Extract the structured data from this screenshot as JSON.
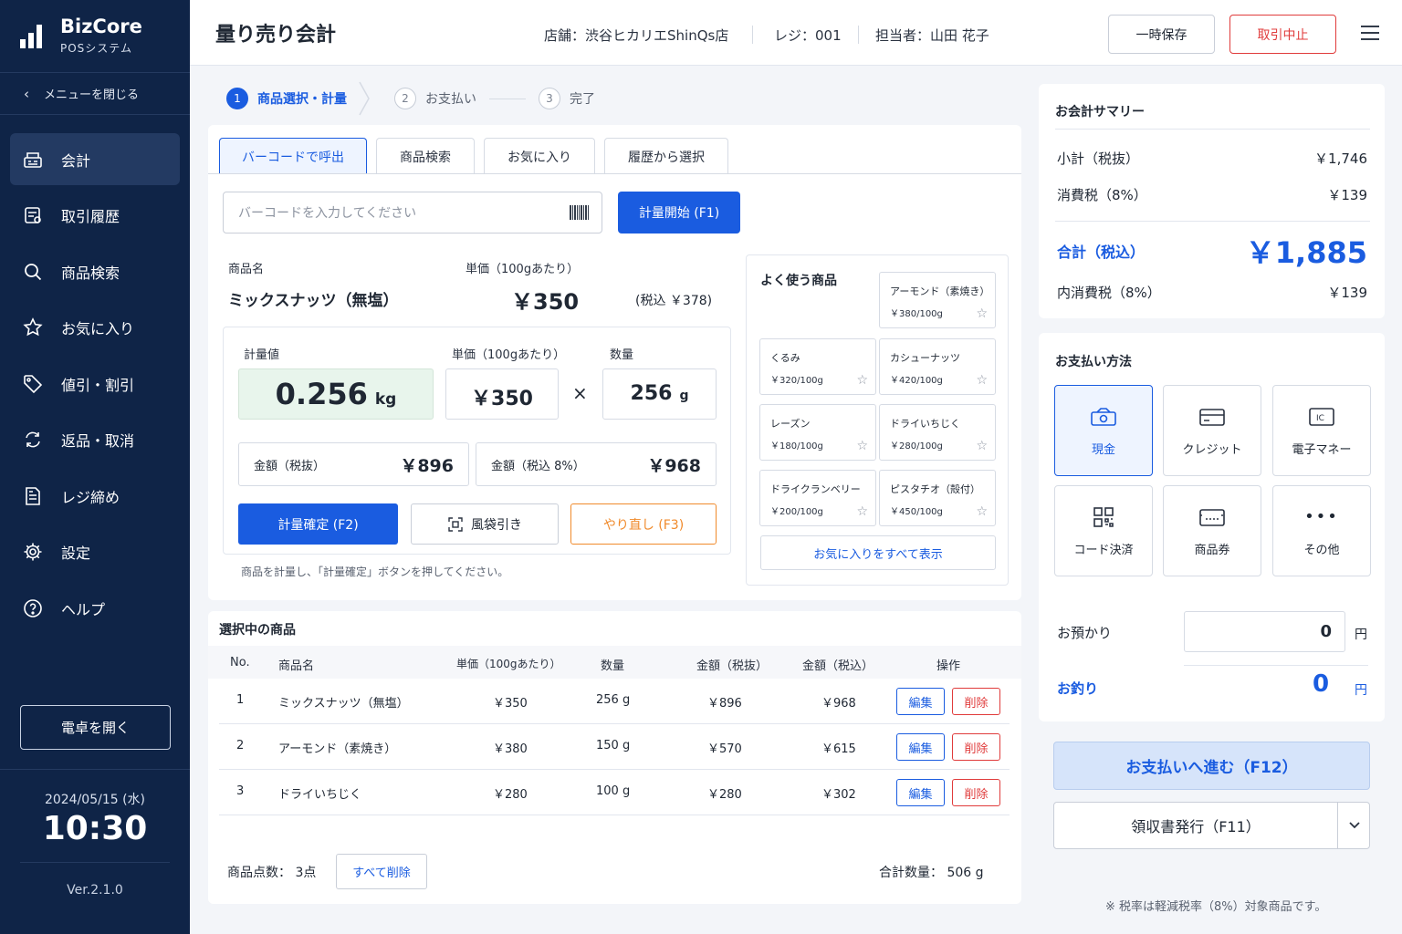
{
  "app": {
    "name": "BizCore",
    "subtitle": "POSシステム"
  },
  "sidebar": {
    "close_menu": "メニューを閉じる",
    "items": [
      {
        "label": "会計",
        "icon": "register-icon",
        "active": true
      },
      {
        "label": "取引履歴",
        "icon": "history-icon"
      },
      {
        "label": "商品検索",
        "icon": "search-icon"
      },
      {
        "label": "お気に入り",
        "icon": "star-icon"
      },
      {
        "label": "値引・割引",
        "icon": "tag-icon"
      },
      {
        "label": "返品・取消",
        "icon": "return-icon"
      },
      {
        "label": "レジ締め",
        "icon": "document-icon"
      },
      {
        "label": "設定",
        "icon": "gear-icon"
      },
      {
        "label": "ヘルプ",
        "icon": "help-icon"
      }
    ],
    "calculator_button": "電卓を開く",
    "date": "2024/05/15 (水)",
    "time": "10:30",
    "version": "Ver.2.1.0"
  },
  "header": {
    "title": "量り売り会計",
    "store": "店舗：渋谷ヒカリエShinQs店",
    "register": "レジ：001",
    "staff": "担当者：山田 花子",
    "save_button": "一時保存",
    "cancel_button": "取引中止"
  },
  "stepper": [
    {
      "num": "1",
      "label": "商品選択・計量",
      "active": true
    },
    {
      "num": "2",
      "label": "お支払い"
    },
    {
      "num": "3",
      "label": "完了"
    }
  ],
  "tabs": [
    "バーコードで呼出",
    "商品検索",
    "お気に入り",
    "履歴から選択"
  ],
  "barcode": {
    "placeholder": "バーコードを入力してください",
    "start_button": "計量開始 (F1)"
  },
  "product": {
    "name_label": "商品名",
    "name": "ミックスナッツ（無塩）",
    "unit_price_label": "単価（100gあたり）",
    "unit_price": "￥350",
    "tax_included": "(税込 ￥378)"
  },
  "weighing": {
    "weight_label": "計量値",
    "weight_value": "0.256",
    "weight_unit": "kg",
    "unit_price_label": "単価（100gあたり）",
    "unit_price": "￥350",
    "times": "×",
    "qty_label": "数量",
    "qty_value": "256",
    "qty_unit": "g",
    "amount_ex_label": "金額（税抜）",
    "amount_ex": "￥896",
    "amount_in_label": "金額（税込 8%）",
    "amount_in": "￥968",
    "confirm_button": "計量確定 (F2)",
    "bag_button": "風袋引き",
    "redo_button": "やり直し (F3)",
    "hint": "商品を計量し、「計量確定」ボタンを押してください。"
  },
  "favorites": {
    "title": "よく使う商品",
    "items": [
      {
        "name": "アーモンド（素焼き）",
        "price": "￥380/100g"
      },
      {
        "name": "くるみ",
        "price": "￥320/100g"
      },
      {
        "name": "カシューナッツ",
        "price": "￥420/100g"
      },
      {
        "name": "レーズン",
        "price": "￥180/100g"
      },
      {
        "name": "ドライいちじく",
        "price": "￥280/100g"
      },
      {
        "name": "ドライクランベリー",
        "price": "￥200/100g"
      },
      {
        "name": "ピスタチオ（殻付）",
        "price": "￥450/100g"
      }
    ],
    "show_all": "お気に入りをすべて表示"
  },
  "selected": {
    "title": "選択中の商品",
    "columns": [
      "No.",
      "商品名",
      "単価（100gあたり）",
      "数量",
      "金額（税抜）",
      "金額（税込）",
      "操作"
    ],
    "rows": [
      {
        "no": "1",
        "name": "ミックスナッツ（無塩）",
        "unit": "￥350",
        "qty": "256 g",
        "ex": "￥896",
        "inc": "￥968"
      },
      {
        "no": "2",
        "name": "アーモンド（素焼き）",
        "unit": "￥380",
        "qty": "150 g",
        "ex": "￥570",
        "inc": "￥615"
      },
      {
        "no": "3",
        "name": "ドライいちじく",
        "unit": "￥280",
        "qty": "100 g",
        "ex": "￥280",
        "inc": "￥302"
      }
    ],
    "edit_label": "編集",
    "delete_label": "削除",
    "count": "商品点数： 3点",
    "clear_all": "すべて削除",
    "total_qty": "合計数量： 506 g"
  },
  "summary": {
    "title": "お会計サマリー",
    "subtotal_label": "小計（税抜）",
    "subtotal": "￥1,746",
    "tax_label": "消費税（8%）",
    "tax": "￥139",
    "total_label": "合計（税込）",
    "total": "￥1,885",
    "inner_tax_label": "内消費税（8%）",
    "inner_tax": "￥139"
  },
  "payment": {
    "title": "お支払い方法",
    "methods": [
      {
        "label": "現金",
        "icon": "cash-icon",
        "active": true
      },
      {
        "label": "クレジット",
        "icon": "credit-card-icon"
      },
      {
        "label": "電子マネー",
        "icon": "ic-card-icon"
      },
      {
        "label": "コード決済",
        "icon": "qr-code-icon"
      },
      {
        "label": "商品券",
        "icon": "voucher-icon"
      },
      {
        "label": "その他",
        "icon": "more-icon"
      }
    ],
    "deposit_label": "お預かり",
    "deposit_value": "0",
    "change_label": "お釣り",
    "change_value": "0",
    "yen": "円"
  },
  "actions": {
    "proceed": "お支払いへ進む（F12）",
    "receipt": "領収書発行（F11）",
    "note": "※ 税率は軽減税率（8%）対象商品です。"
  },
  "colors": {
    "sidebar": "#0f2447",
    "primary": "#1a5ce0",
    "danger": "#e03b3b",
    "warning": "#f08a2b",
    "weight_bg": "#e8f5ec"
  }
}
